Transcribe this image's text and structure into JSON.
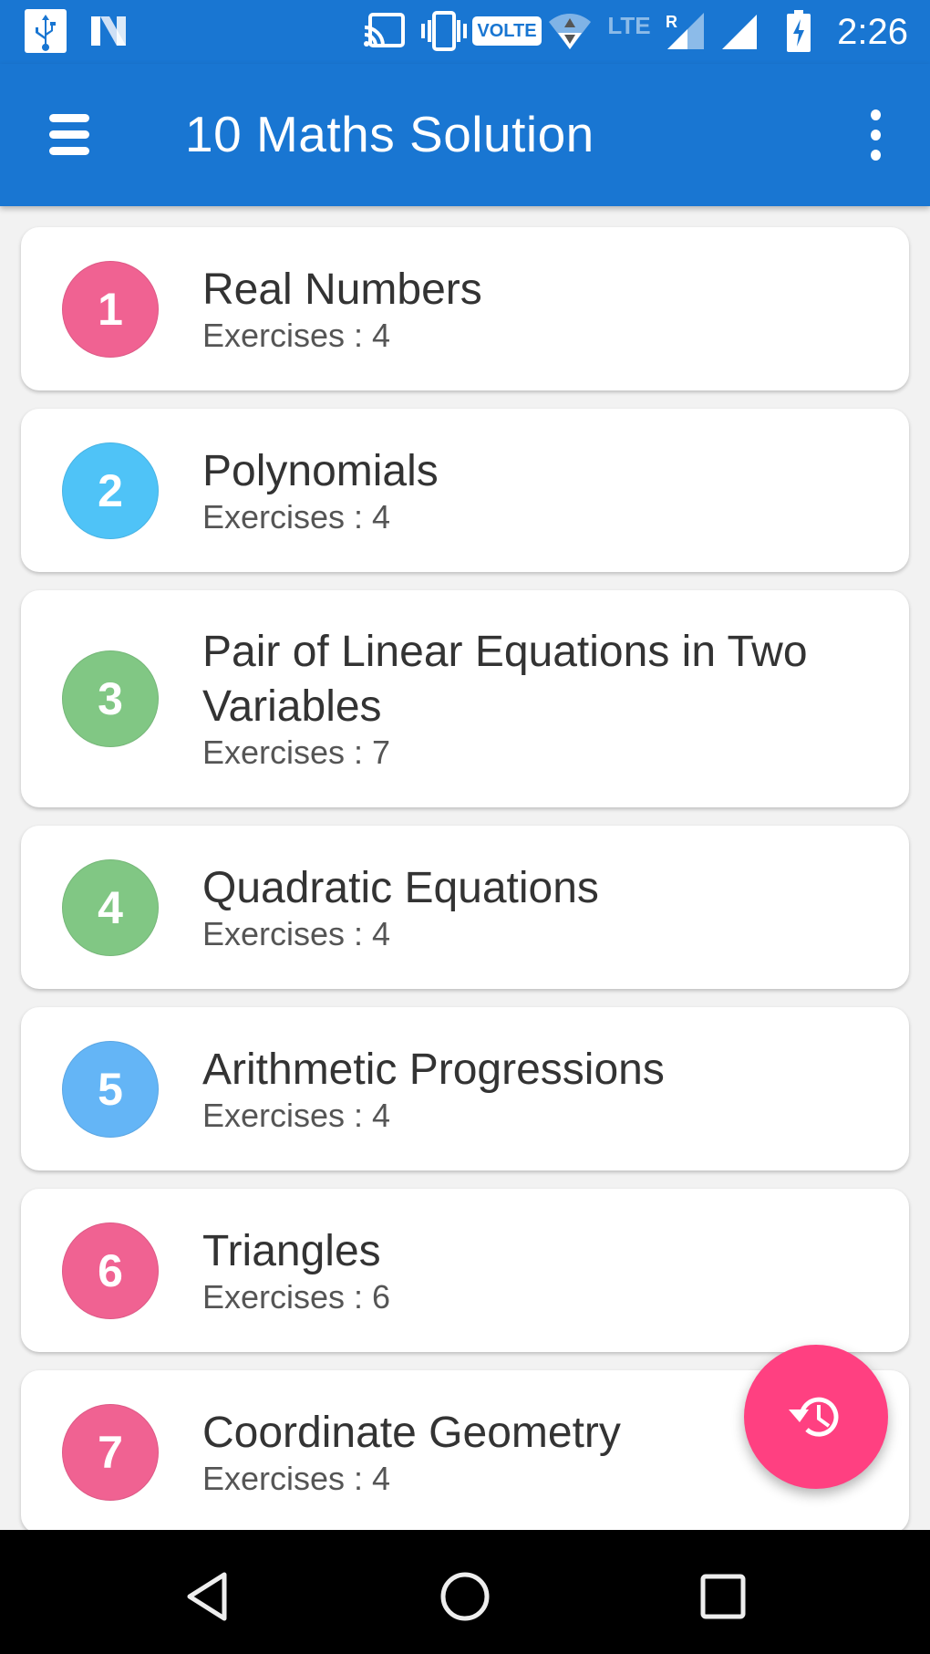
{
  "status_bar": {
    "time": "2:26",
    "icons": [
      "usb-icon",
      "n-notification-icon",
      "cast-icon",
      "vibrate-icon",
      "volte-icon",
      "wifi-data-icon",
      "lte-roaming-signal-icon",
      "signal-icon",
      "battery-charging-icon"
    ],
    "volte_label": "VOLTE",
    "lte_label": "LTE",
    "roaming_label": "R"
  },
  "app_bar": {
    "title": "10 Maths Solution",
    "menu_icon": "hamburger-menu-icon",
    "more_icon": "more-vert-icon",
    "color": "#1976d2"
  },
  "chapters": [
    {
      "number": "1",
      "title": "Real Numbers",
      "exercises": "Exercises : 4",
      "color": "#f06292"
    },
    {
      "number": "2",
      "title": "Polynomials",
      "exercises": "Exercises : 4",
      "color": "#4fc3f7"
    },
    {
      "number": "3",
      "title": "Pair of Linear Equations in Two Variables",
      "exercises": "Exercises : 7",
      "color": "#81c784"
    },
    {
      "number": "4",
      "title": "Quadratic Equations",
      "exercises": "Exercises : 4",
      "color": "#81c784"
    },
    {
      "number": "5",
      "title": "Arithmetic Progressions",
      "exercises": "Exercises : 4",
      "color": "#64b5f6"
    },
    {
      "number": "6",
      "title": "Triangles",
      "exercises": "Exercises : 6",
      "color": "#f06292"
    },
    {
      "number": "7",
      "title": "Coordinate Geometry",
      "exercises": "Exercises : 4",
      "color": "#f06292"
    }
  ],
  "fab": {
    "icon": "history-icon",
    "color": "#ff4081"
  },
  "nav_bar": {
    "back_icon": "back-icon",
    "home_icon": "home-icon",
    "recents_icon": "recents-icon"
  }
}
